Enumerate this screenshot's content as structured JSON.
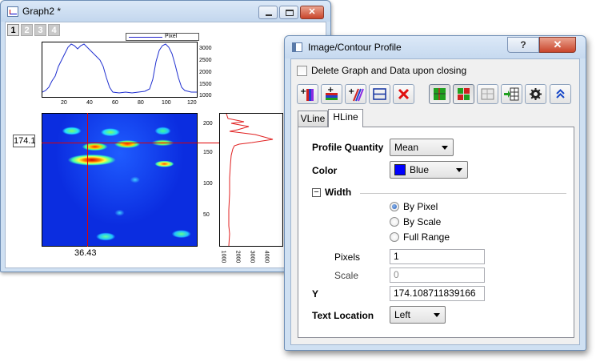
{
  "graph_window": {
    "title": "Graph2 *",
    "layers": [
      "1",
      "2",
      "3",
      "4"
    ],
    "legend_label": "Pixel",
    "top_plot": {
      "x_ticks": [
        "20",
        "40",
        "60",
        "80",
        "100",
        "120"
      ],
      "y_ticks": [
        "3000",
        "2500",
        "2000",
        "1500",
        "1000"
      ]
    },
    "heatmap": {
      "y_ticks": [
        "200",
        "150",
        "100",
        "50"
      ]
    },
    "side_plot": {
      "x_ticks": [
        "1000",
        "2000",
        "3000",
        "4000"
      ]
    },
    "y_cursor_value": "174.1",
    "x_cursor_value": "36.43"
  },
  "dialog": {
    "title": "Image/Contour Profile",
    "help_label": "?",
    "close_label": "✕",
    "delete_checkbox_label": "Delete Graph and Data upon closing",
    "toolbar_icons": [
      "add-vertical-line-icon",
      "add-horizontal-line-icon",
      "add-arbitrary-line-icon",
      "horizontal-lines-icon",
      "delete-icon",
      "crosshair-graph-icon",
      "grid-color-icon",
      "preview-icon",
      "export-table-icon",
      "settings-gear-icon",
      "collapse-chevron-icon"
    ],
    "tabs": [
      {
        "label": "VLine",
        "active": false
      },
      {
        "label": "HLine",
        "active": true
      }
    ],
    "profile_quantity": {
      "label": "Profile Quantity",
      "value": "Mean"
    },
    "color": {
      "label": "Color",
      "value": "Blue",
      "swatch": "#0000ff"
    },
    "width_group": {
      "label": "Width",
      "collapse_symbol": "−",
      "options": [
        {
          "label": "By Pixel",
          "selected": true
        },
        {
          "label": "By Scale",
          "selected": false
        },
        {
          "label": "Full Range",
          "selected": false
        }
      ],
      "pixels": {
        "label": "Pixels",
        "value": "1"
      },
      "scale": {
        "label": "Scale",
        "value": "0"
      }
    },
    "y": {
      "label": "Y",
      "value": "174.108711839166"
    },
    "text_location": {
      "label": "Text Location",
      "value": "Left"
    }
  }
}
